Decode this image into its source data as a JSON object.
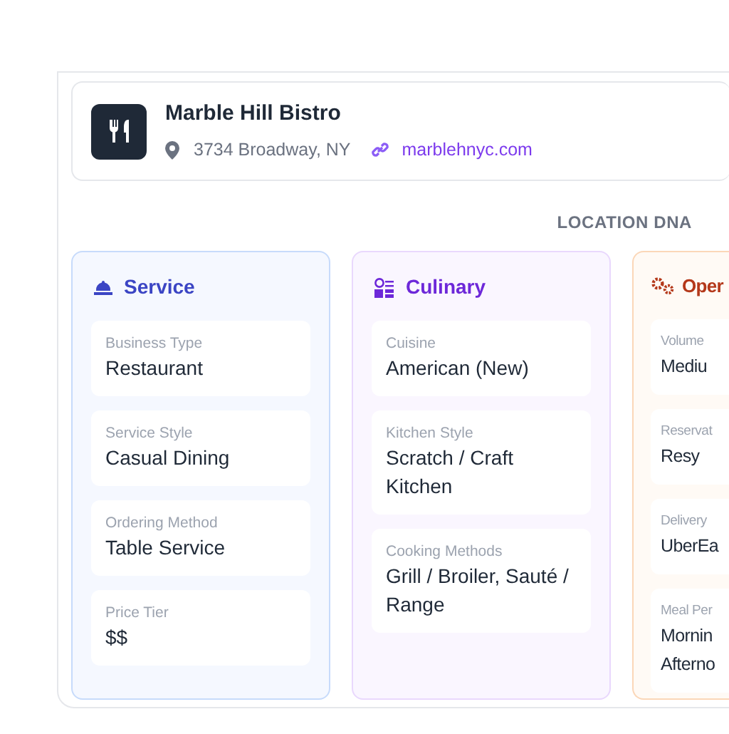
{
  "business": {
    "name": "Marble Hill Bistro",
    "address": "3734 Broadway, NY",
    "website": "marblehnyc.com"
  },
  "section_title": "LOCATION DNA",
  "columns": [
    {
      "title": "Service",
      "kind": "service",
      "fields": [
        {
          "label": "Business Type",
          "value": "Restaurant"
        },
        {
          "label": "Service Style",
          "value": "Casual Dining"
        },
        {
          "label": "Ordering Method",
          "value": "Table Service"
        },
        {
          "label": "Price Tier",
          "value": "$$"
        }
      ]
    },
    {
      "title": "Culinary",
      "kind": "culinary",
      "fields": [
        {
          "label": "Cuisine",
          "value": "American (New)"
        },
        {
          "label": "Kitchen Style",
          "value": "Scratch / Craft Kitchen"
        },
        {
          "label": "Cooking Methods",
          "value": "Grill / Broiler, Sauté / Range"
        }
      ]
    },
    {
      "title": "Oper",
      "kind": "operations",
      "fields": [
        {
          "label": "Volume",
          "value": "Mediu"
        },
        {
          "label": "Reservat",
          "value": "Resy"
        },
        {
          "label": "Delivery",
          "value": "UberEa"
        },
        {
          "label": "Meal Per",
          "value": "Mornin Afterno"
        }
      ]
    }
  ]
}
